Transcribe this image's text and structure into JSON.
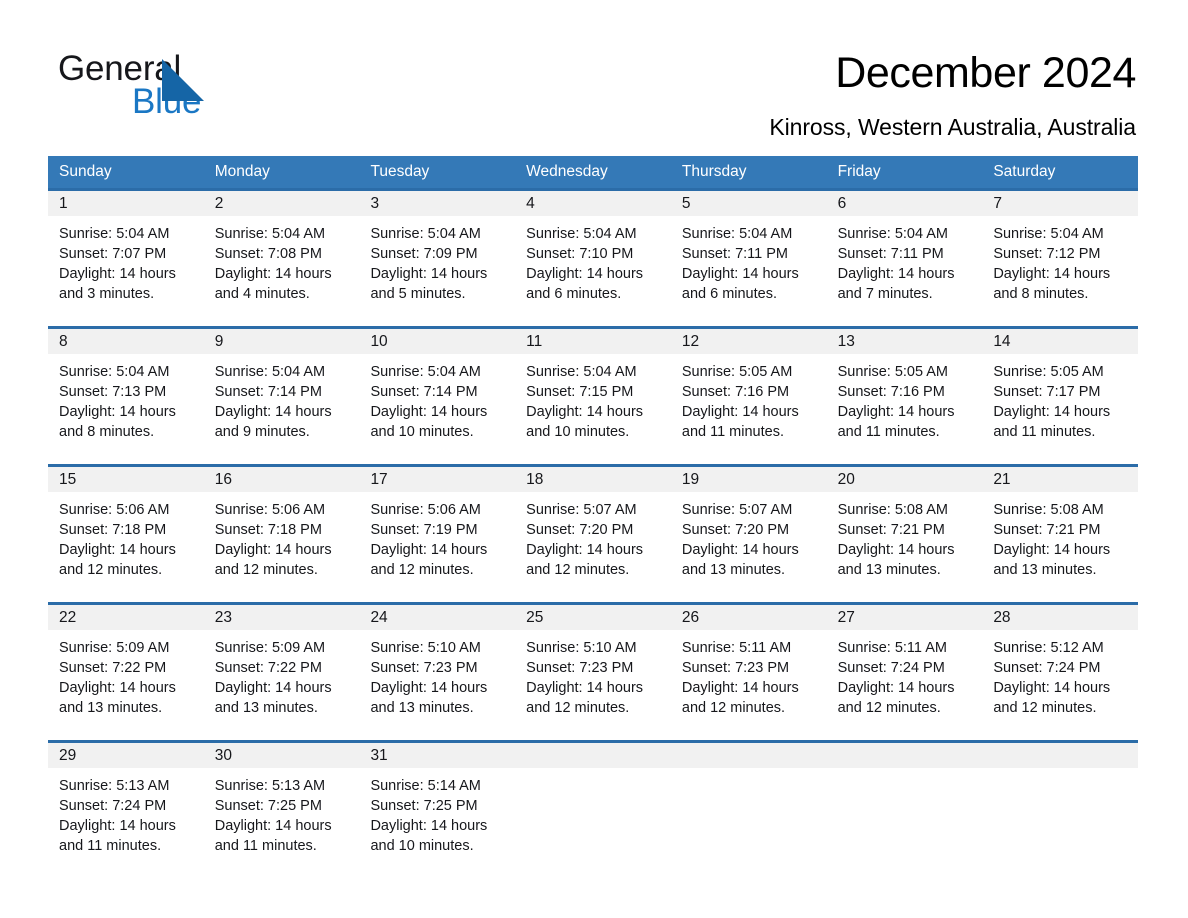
{
  "brand": {
    "name_part1": "General",
    "name_part2": "Blue",
    "accent_color": "#1a77c4"
  },
  "header": {
    "title": "December 2024",
    "subtitle": "Kinross, Western Australia, Australia"
  },
  "calendar": {
    "header_bg": "#3479b7",
    "row_divider_color": "#2b6ca8",
    "daynumber_bg": "#f1f1f1",
    "weekdays": [
      "Sunday",
      "Monday",
      "Tuesday",
      "Wednesday",
      "Thursday",
      "Friday",
      "Saturday"
    ],
    "weeks": [
      [
        {
          "day": "1",
          "sunrise": "Sunrise: 5:04 AM",
          "sunset": "Sunset: 7:07 PM",
          "daylight_line1": "Daylight: 14 hours",
          "daylight_line2": "and 3 minutes."
        },
        {
          "day": "2",
          "sunrise": "Sunrise: 5:04 AM",
          "sunset": "Sunset: 7:08 PM",
          "daylight_line1": "Daylight: 14 hours",
          "daylight_line2": "and 4 minutes."
        },
        {
          "day": "3",
          "sunrise": "Sunrise: 5:04 AM",
          "sunset": "Sunset: 7:09 PM",
          "daylight_line1": "Daylight: 14 hours",
          "daylight_line2": "and 5 minutes."
        },
        {
          "day": "4",
          "sunrise": "Sunrise: 5:04 AM",
          "sunset": "Sunset: 7:10 PM",
          "daylight_line1": "Daylight: 14 hours",
          "daylight_line2": "and 6 minutes."
        },
        {
          "day": "5",
          "sunrise": "Sunrise: 5:04 AM",
          "sunset": "Sunset: 7:11 PM",
          "daylight_line1": "Daylight: 14 hours",
          "daylight_line2": "and 6 minutes."
        },
        {
          "day": "6",
          "sunrise": "Sunrise: 5:04 AM",
          "sunset": "Sunset: 7:11 PM",
          "daylight_line1": "Daylight: 14 hours",
          "daylight_line2": "and 7 minutes."
        },
        {
          "day": "7",
          "sunrise": "Sunrise: 5:04 AM",
          "sunset": "Sunset: 7:12 PM",
          "daylight_line1": "Daylight: 14 hours",
          "daylight_line2": "and 8 minutes."
        }
      ],
      [
        {
          "day": "8",
          "sunrise": "Sunrise: 5:04 AM",
          "sunset": "Sunset: 7:13 PM",
          "daylight_line1": "Daylight: 14 hours",
          "daylight_line2": "and 8 minutes."
        },
        {
          "day": "9",
          "sunrise": "Sunrise: 5:04 AM",
          "sunset": "Sunset: 7:14 PM",
          "daylight_line1": "Daylight: 14 hours",
          "daylight_line2": "and 9 minutes."
        },
        {
          "day": "10",
          "sunrise": "Sunrise: 5:04 AM",
          "sunset": "Sunset: 7:14 PM",
          "daylight_line1": "Daylight: 14 hours",
          "daylight_line2": "and 10 minutes."
        },
        {
          "day": "11",
          "sunrise": "Sunrise: 5:04 AM",
          "sunset": "Sunset: 7:15 PM",
          "daylight_line1": "Daylight: 14 hours",
          "daylight_line2": "and 10 minutes."
        },
        {
          "day": "12",
          "sunrise": "Sunrise: 5:05 AM",
          "sunset": "Sunset: 7:16 PM",
          "daylight_line1": "Daylight: 14 hours",
          "daylight_line2": "and 11 minutes."
        },
        {
          "day": "13",
          "sunrise": "Sunrise: 5:05 AM",
          "sunset": "Sunset: 7:16 PM",
          "daylight_line1": "Daylight: 14 hours",
          "daylight_line2": "and 11 minutes."
        },
        {
          "day": "14",
          "sunrise": "Sunrise: 5:05 AM",
          "sunset": "Sunset: 7:17 PM",
          "daylight_line1": "Daylight: 14 hours",
          "daylight_line2": "and 11 minutes."
        }
      ],
      [
        {
          "day": "15",
          "sunrise": "Sunrise: 5:06 AM",
          "sunset": "Sunset: 7:18 PM",
          "daylight_line1": "Daylight: 14 hours",
          "daylight_line2": "and 12 minutes."
        },
        {
          "day": "16",
          "sunrise": "Sunrise: 5:06 AM",
          "sunset": "Sunset: 7:18 PM",
          "daylight_line1": "Daylight: 14 hours",
          "daylight_line2": "and 12 minutes."
        },
        {
          "day": "17",
          "sunrise": "Sunrise: 5:06 AM",
          "sunset": "Sunset: 7:19 PM",
          "daylight_line1": "Daylight: 14 hours",
          "daylight_line2": "and 12 minutes."
        },
        {
          "day": "18",
          "sunrise": "Sunrise: 5:07 AM",
          "sunset": "Sunset: 7:20 PM",
          "daylight_line1": "Daylight: 14 hours",
          "daylight_line2": "and 12 minutes."
        },
        {
          "day": "19",
          "sunrise": "Sunrise: 5:07 AM",
          "sunset": "Sunset: 7:20 PM",
          "daylight_line1": "Daylight: 14 hours",
          "daylight_line2": "and 13 minutes."
        },
        {
          "day": "20",
          "sunrise": "Sunrise: 5:08 AM",
          "sunset": "Sunset: 7:21 PM",
          "daylight_line1": "Daylight: 14 hours",
          "daylight_line2": "and 13 minutes."
        },
        {
          "day": "21",
          "sunrise": "Sunrise: 5:08 AM",
          "sunset": "Sunset: 7:21 PM",
          "daylight_line1": "Daylight: 14 hours",
          "daylight_line2": "and 13 minutes."
        }
      ],
      [
        {
          "day": "22",
          "sunrise": "Sunrise: 5:09 AM",
          "sunset": "Sunset: 7:22 PM",
          "daylight_line1": "Daylight: 14 hours",
          "daylight_line2": "and 13 minutes."
        },
        {
          "day": "23",
          "sunrise": "Sunrise: 5:09 AM",
          "sunset": "Sunset: 7:22 PM",
          "daylight_line1": "Daylight: 14 hours",
          "daylight_line2": "and 13 minutes."
        },
        {
          "day": "24",
          "sunrise": "Sunrise: 5:10 AM",
          "sunset": "Sunset: 7:23 PM",
          "daylight_line1": "Daylight: 14 hours",
          "daylight_line2": "and 13 minutes."
        },
        {
          "day": "25",
          "sunrise": "Sunrise: 5:10 AM",
          "sunset": "Sunset: 7:23 PM",
          "daylight_line1": "Daylight: 14 hours",
          "daylight_line2": "and 12 minutes."
        },
        {
          "day": "26",
          "sunrise": "Sunrise: 5:11 AM",
          "sunset": "Sunset: 7:23 PM",
          "daylight_line1": "Daylight: 14 hours",
          "daylight_line2": "and 12 minutes."
        },
        {
          "day": "27",
          "sunrise": "Sunrise: 5:11 AM",
          "sunset": "Sunset: 7:24 PM",
          "daylight_line1": "Daylight: 14 hours",
          "daylight_line2": "and 12 minutes."
        },
        {
          "day": "28",
          "sunrise": "Sunrise: 5:12 AM",
          "sunset": "Sunset: 7:24 PM",
          "daylight_line1": "Daylight: 14 hours",
          "daylight_line2": "and 12 minutes."
        }
      ],
      [
        {
          "day": "29",
          "sunrise": "Sunrise: 5:13 AM",
          "sunset": "Sunset: 7:24 PM",
          "daylight_line1": "Daylight: 14 hours",
          "daylight_line2": "and 11 minutes."
        },
        {
          "day": "30",
          "sunrise": "Sunrise: 5:13 AM",
          "sunset": "Sunset: 7:25 PM",
          "daylight_line1": "Daylight: 14 hours",
          "daylight_line2": "and 11 minutes."
        },
        {
          "day": "31",
          "sunrise": "Sunrise: 5:14 AM",
          "sunset": "Sunset: 7:25 PM",
          "daylight_line1": "Daylight: 14 hours",
          "daylight_line2": "and 10 minutes."
        },
        {
          "day": "",
          "sunrise": "",
          "sunset": "",
          "daylight_line1": "",
          "daylight_line2": ""
        },
        {
          "day": "",
          "sunrise": "",
          "sunset": "",
          "daylight_line1": "",
          "daylight_line2": ""
        },
        {
          "day": "",
          "sunrise": "",
          "sunset": "",
          "daylight_line1": "",
          "daylight_line2": ""
        },
        {
          "day": "",
          "sunrise": "",
          "sunset": "",
          "daylight_line1": "",
          "daylight_line2": ""
        }
      ]
    ]
  }
}
